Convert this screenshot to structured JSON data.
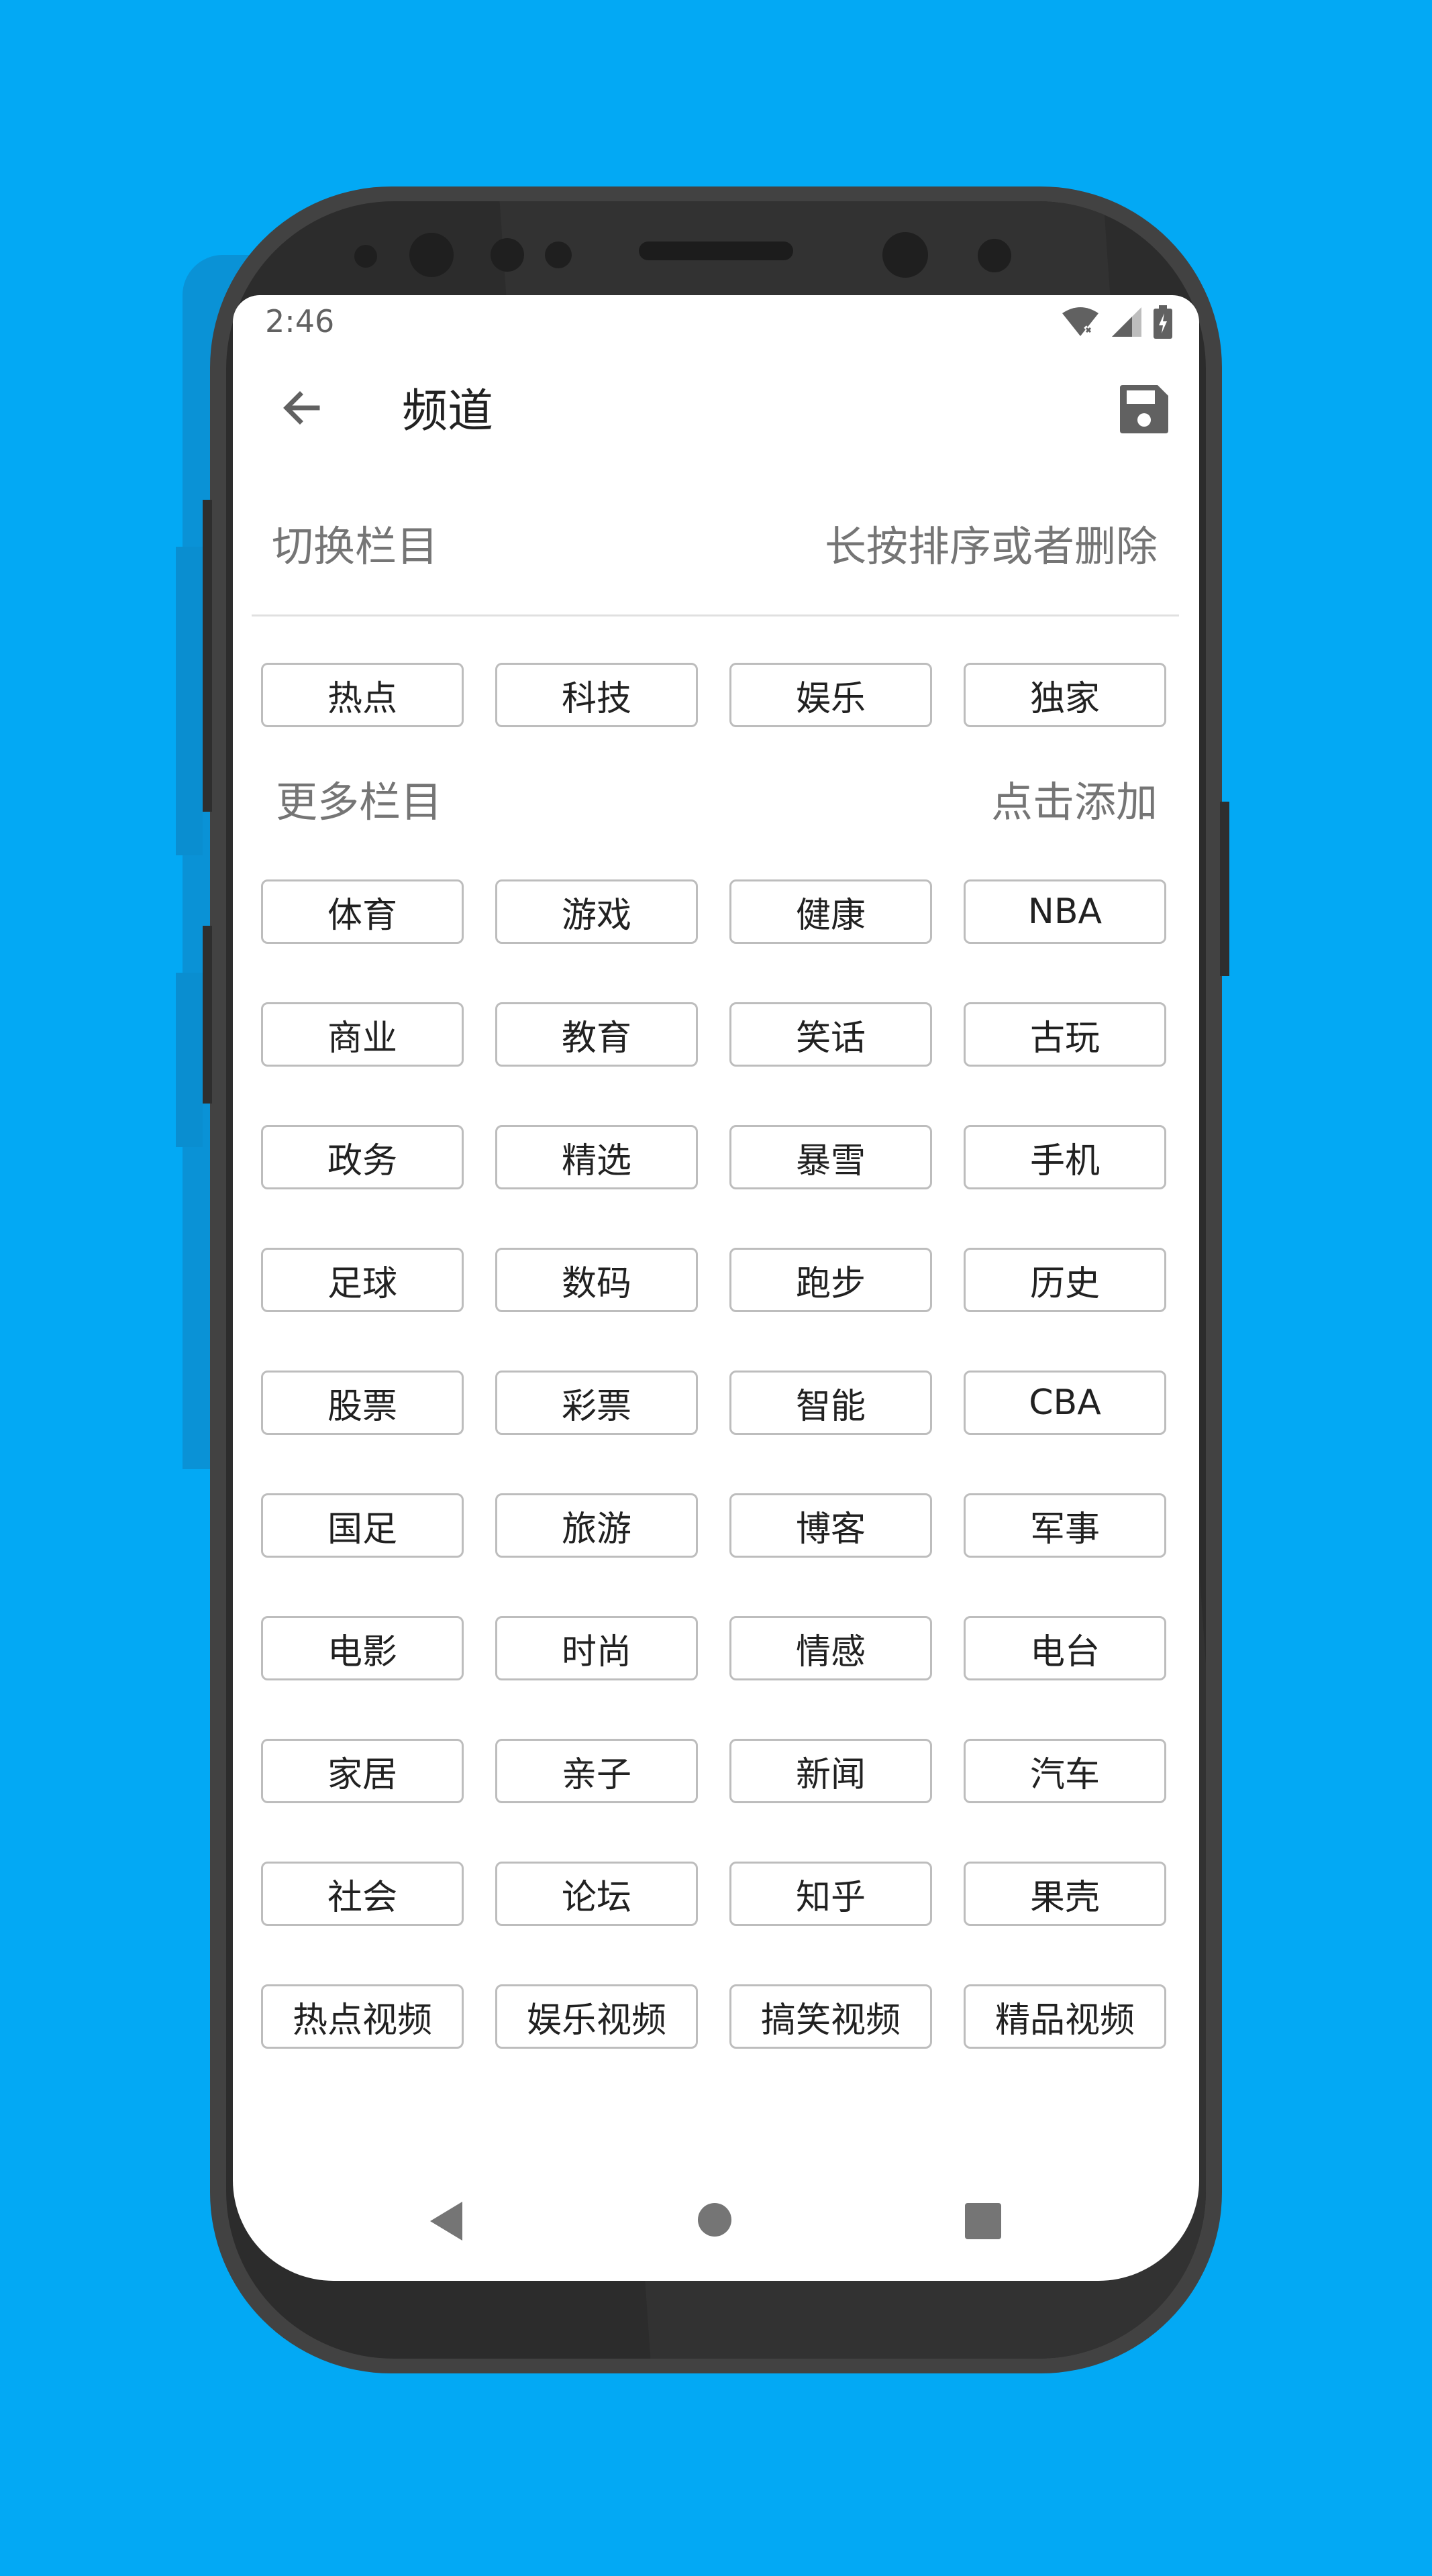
{
  "status_bar": {
    "time": "2:46"
  },
  "app_bar": {
    "title": "频道"
  },
  "my_channels": {
    "title": "切换栏目",
    "hint": "长按排序或者删除",
    "items": [
      "热点",
      "科技",
      "娱乐",
      "独家"
    ]
  },
  "more_channels": {
    "title": "更多栏目",
    "hint": "点击添加",
    "items": [
      "体育",
      "游戏",
      "健康",
      "NBA",
      "商业",
      "教育",
      "笑话",
      "古玩",
      "政务",
      "精选",
      "暴雪",
      "手机",
      "足球",
      "数码",
      "跑步",
      "历史",
      "股票",
      "彩票",
      "智能",
      "CBA",
      "国足",
      "旅游",
      "博客",
      "军事",
      "电影",
      "时尚",
      "情感",
      "电台",
      "家居",
      "亲子",
      "新闻",
      "汽车",
      "社会",
      "论坛",
      "知乎",
      "果壳",
      "热点视频",
      "娱乐视频",
      "搞笑视频",
      "精品视频"
    ]
  },
  "icons": {
    "back": "arrow-back-icon",
    "save": "save-icon",
    "wifi": "wifi-off-icon",
    "signal": "signal-icon",
    "battery": "battery-charging-icon"
  },
  "colors": {
    "background": "#03A9F4",
    "chip_border": "#BDBDBD",
    "secondary_text": "#757575"
  }
}
